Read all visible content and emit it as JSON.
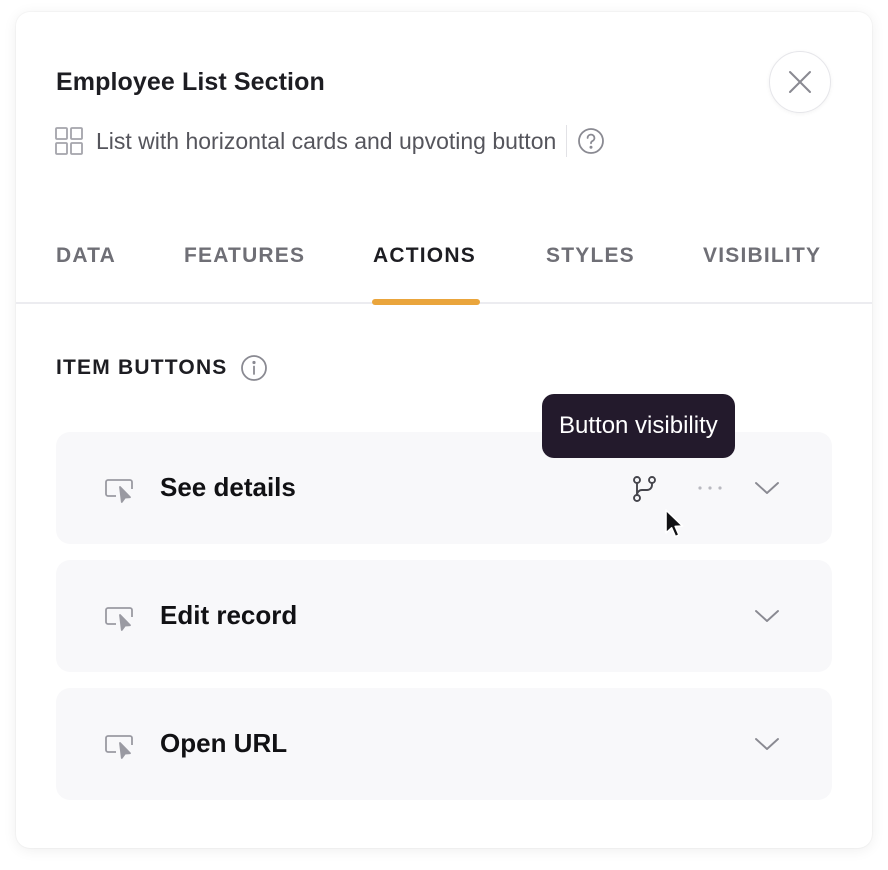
{
  "header": {
    "title": "Employee List Section",
    "subtitle": "List with horizontal cards and upvoting button",
    "subtitle_icon": "grid-icon",
    "help_icon": "question-circle-icon",
    "close_icon": "close-icon"
  },
  "tabs": [
    {
      "label": "DATA",
      "active": false
    },
    {
      "label": "FEATURES",
      "active": false
    },
    {
      "label": "ACTIONS",
      "active": true
    },
    {
      "label": "STYLES",
      "active": false
    },
    {
      "label": "VISIBILITY",
      "active": false
    }
  ],
  "section": {
    "title": "ITEM BUTTONS",
    "info_icon": "info-circle-icon"
  },
  "item_buttons": [
    {
      "label": "See details",
      "icon": "cursor-click-icon"
    },
    {
      "label": "Edit record",
      "icon": "cursor-click-icon"
    },
    {
      "label": "Open URL",
      "icon": "cursor-click-icon"
    }
  ],
  "tooltip": {
    "text": "Button visibility"
  },
  "colors": {
    "accent": "#eaa53c",
    "tooltip_bg": "#231a2c",
    "row_bg": "#f8f8fa"
  }
}
